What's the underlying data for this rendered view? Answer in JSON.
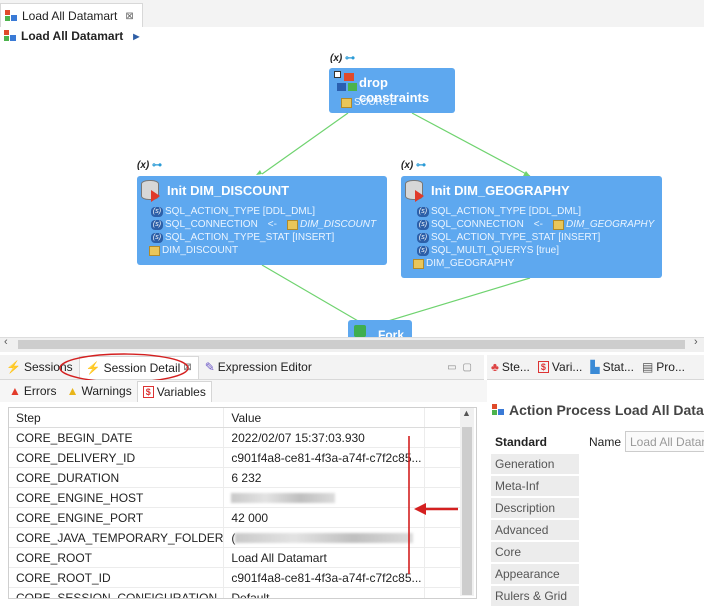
{
  "editor": {
    "tab_title": "Load All Datamart",
    "breadcrumb": "Load All Datamart"
  },
  "canvas": {
    "param_badge": "(x)",
    "nodes": {
      "drop": {
        "title": "drop constraints",
        "line1": "SOURCE"
      },
      "discount": {
        "title": "Init DIM_DISCOUNT",
        "l1": "SQL_ACTION_TYPE [DDL_DML]",
        "l2a": "SQL_CONNECTION",
        "l2arrow": "<-",
        "l2b": "DIM_DISCOUNT",
        "l3": "SQL_ACTION_TYPE_STAT [INSERT]",
        "l4": "DIM_DISCOUNT"
      },
      "geo": {
        "title": "Init DIM_GEOGRAPHY",
        "l1": "SQL_ACTION_TYPE [DDL_DML]",
        "l2a": "SQL_CONNECTION",
        "l2arrow": "<-",
        "l2b": "DIM_GEOGRAPHY",
        "l3": "SQL_ACTION_TYPE_STAT [INSERT]",
        "l4": "SQL_MULTI_QUERYS [true]",
        "l5": "DIM_GEOGRAPHY"
      },
      "fork": {
        "title": "Fork"
      }
    }
  },
  "left_panel": {
    "tabs": [
      "Sessions",
      "Session Detail",
      "Expression Editor"
    ],
    "sub_tabs": [
      "Errors",
      "Warnings",
      "Variables"
    ],
    "table": {
      "headers": [
        "Step",
        "Value"
      ],
      "rows": [
        [
          "CORE_BEGIN_DATE",
          "2022/02/07 15:37:03.930"
        ],
        [
          "CORE_DELIVERY_ID",
          "c901f4a8-ce81-4f3a-a74f-c7f2c85..."
        ],
        [
          "CORE_DURATION",
          "6 232"
        ],
        [
          "CORE_ENGINE_HOST",
          ""
        ],
        [
          "CORE_ENGINE_PORT",
          "42 000"
        ],
        [
          "CORE_JAVA_TEMPORARY_FOLDER",
          "("
        ],
        [
          "CORE_ROOT",
          "Load All Datamart"
        ],
        [
          "CORE_ROOT_ID",
          "c901f4a8-ce81-4f3a-a74f-c7f2c85..."
        ],
        [
          "CORE_SESSION_CONFIGURATION",
          "Default"
        ]
      ]
    }
  },
  "right_panel": {
    "tabs": [
      "Ste...",
      "Vari...",
      "Stat...",
      "Pro..."
    ],
    "title": "Action Process Load All Data",
    "categories": [
      "Standard",
      "Generation",
      "Meta-Inf",
      "Description",
      "Advanced",
      "Core",
      "Appearance",
      "Rulers & Grid"
    ],
    "name_label": "Name",
    "name_value": "Load All Datamart"
  },
  "colors": {
    "node_blue": "#5ea8ef",
    "link_green": "#6fd36f",
    "highlight_red": "#d42020"
  }
}
